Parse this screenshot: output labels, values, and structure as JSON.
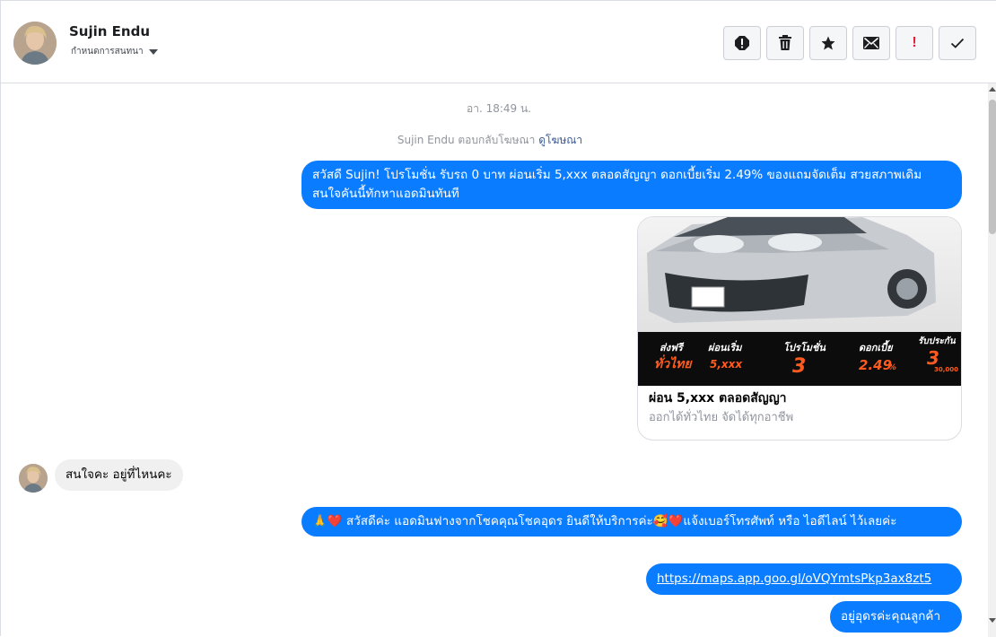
{
  "header": {
    "contact_name": "Sujin Endu",
    "assign_label": "กำหนดการสนทนา",
    "actions": [
      {
        "name": "report-icon",
        "label": "!"
      },
      {
        "name": "trash-icon"
      },
      {
        "name": "star-icon"
      },
      {
        "name": "envelope-icon"
      },
      {
        "name": "priority-icon",
        "label": "!"
      },
      {
        "name": "checkmark-icon"
      }
    ]
  },
  "conversation": {
    "timestamp": "อา. 18:49 น.",
    "reply_note": "Sujin Endu ตอบกลับโฆษณา",
    "reply_link": "ดูโฆษณา",
    "messages": [
      {
        "from": "page",
        "text": "สวัสดี Sujin! โปรโมชั่น รับรถ 0 บาท ผ่อนเริ่ม 5,xxx ตลอดสัญญา ดอกเบี้ยเริ่ม 2.49% ของแถมจัดเต็ม สวยสภาพเดิม สนใจคันนี้ทักหาแอดมินทันที"
      },
      {
        "from": "user",
        "text": "สนใจคะ อยู่ที่ไหนคะ"
      },
      {
        "from": "page",
        "text": "🙏❤️ สวัสดีค่ะ แอดมินฟางจากโชคคุณโชคอุดร ยินดีให้บริการค่ะ🥰❤️แจ้งเบอร์โทรศัพท์ หรือ ไอดีไลน์  ไว้เลยค่ะ"
      },
      {
        "from": "page",
        "text": "https://maps.app.goo.gl/oVQYmtsPkp3ax8zt5"
      },
      {
        "from": "page",
        "text": "อยู่อุดรค่ะคุณลูกค้า"
      }
    ],
    "ad_card": {
      "title": "ผ่อน 5,xxx ตลอดสัญญา",
      "subtitle": "ออกได้ทั่วไทย จัดได้ทุกอาชีพ",
      "banner": {
        "col1_top": "ส่งฟรี",
        "col1_bottom": "ทั่วไทย",
        "col2_top": "ผ่อนเริ่ม",
        "col2_bottom": "5,xxx",
        "col3_top": "โปรโมชั่น",
        "col3_bottom": "3",
        "col4_top": "ดอกเบี้ย",
        "col4_bottom": "2.49",
        "col4_unit": "%",
        "col5_top": "รับประกัน",
        "col5_bottom": "3",
        "col5_note": "30,000"
      }
    }
  },
  "colors": {
    "bubble_out": "#0a7cff",
    "bubble_in": "#f0f0f0",
    "banner_accent": "#ff5a1f"
  }
}
